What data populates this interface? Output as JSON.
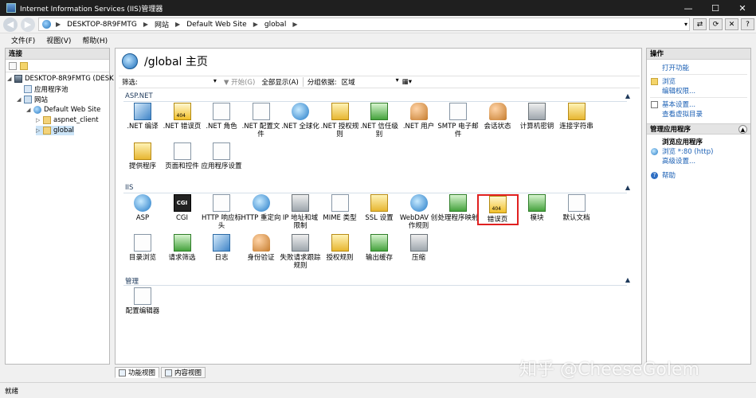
{
  "window": {
    "title": "Internet Information Services (IIS)管理器",
    "controls": {
      "minimize": "—",
      "maximize": "☐",
      "close": "✕"
    }
  },
  "address": {
    "crumbs": [
      "DESKTOP-8R9FMTG",
      "网站",
      "Default Web Site",
      "global"
    ]
  },
  "menu": {
    "file": "文件(F)",
    "view": "视图(V)",
    "help": "帮助(H)"
  },
  "left": {
    "header": "连接",
    "tree": {
      "server": "DESKTOP-8R9FMTG (DESK",
      "apppools": "应用程序池",
      "sites": "网站",
      "default_site": "Default Web Site",
      "aspnet_client": "aspnet_client",
      "global": "global"
    }
  },
  "main": {
    "title": "/global 主页",
    "filter": {
      "label": "筛选:",
      "go": "▼ 开始(G)",
      "show_all": "全部显示(A)",
      "group_label": "分组依据:",
      "group_value": "区域"
    },
    "sections": {
      "aspnet": "ASP.NET",
      "iis": "IIS",
      "manage": "管理"
    },
    "aspnet_features": [
      {
        "label": ".NET 编译"
      },
      {
        "label": ".NET 错误页"
      },
      {
        "label": ".NET 角色"
      },
      {
        "label": ".NET 配置文件"
      },
      {
        "label": ".NET 全球化"
      },
      {
        "label": ".NET 授权规则"
      },
      {
        "label": ".NET 信任级别"
      },
      {
        "label": ".NET 用户"
      },
      {
        "label": "SMTP 电子邮件"
      },
      {
        "label": "会话状态"
      },
      {
        "label": "计算机密钥"
      },
      {
        "label": "连接字符串"
      },
      {
        "label": "提供程序"
      },
      {
        "label": "页面和控件"
      },
      {
        "label": "应用程序设置"
      }
    ],
    "iis_features": [
      {
        "label": "ASP",
        "icon": ""
      },
      {
        "label": "CGI",
        "icon": "CGI"
      },
      {
        "label": "HTTP 响应标头",
        "icon": ""
      },
      {
        "label": "HTTP 重定向",
        "icon": ""
      },
      {
        "label": "IP 地址和域限制",
        "icon": ""
      },
      {
        "label": "MIME 类型",
        "icon": ""
      },
      {
        "label": "SSL 设置",
        "icon": ""
      },
      {
        "label": "WebDAV 创作规则",
        "icon": ""
      },
      {
        "label": "处理程序映射",
        "icon": ""
      },
      {
        "label": "错误页",
        "icon": ""
      },
      {
        "label": "模块",
        "icon": ""
      },
      {
        "label": "默认文档",
        "icon": ""
      },
      {
        "label": "目录浏览",
        "icon": ""
      },
      {
        "label": "请求筛选",
        "icon": ""
      },
      {
        "label": "日志",
        "icon": ""
      },
      {
        "label": "身份验证",
        "icon": ""
      },
      {
        "label": "失败请求跟踪规则",
        "icon": ""
      },
      {
        "label": "授权规则",
        "icon": ""
      },
      {
        "label": "输出缓存",
        "icon": ""
      },
      {
        "label": "压缩",
        "icon": ""
      }
    ],
    "manage_features": [
      {
        "label": "配置编辑器"
      }
    ]
  },
  "bottom_tabs": {
    "features": "功能视图",
    "content": "内容视图"
  },
  "right": {
    "header": "操作",
    "open_feature": "打开功能",
    "browse": "浏览",
    "edit_perms": "编辑权限...",
    "basic_settings": "基本设置...",
    "view_vdirs": "查看虚拟目录",
    "manage_app": "管理应用程序",
    "browse_app": "浏览应用程序",
    "browse_port": "浏览 *:80 (http)",
    "advanced": "高级设置...",
    "help": "帮助"
  },
  "status": {
    "text": "就绪"
  },
  "watermark": "知乎 @CheeseGolem",
  "colors": {
    "selection_outline": "#e02020",
    "link": "#1a5fb4"
  }
}
